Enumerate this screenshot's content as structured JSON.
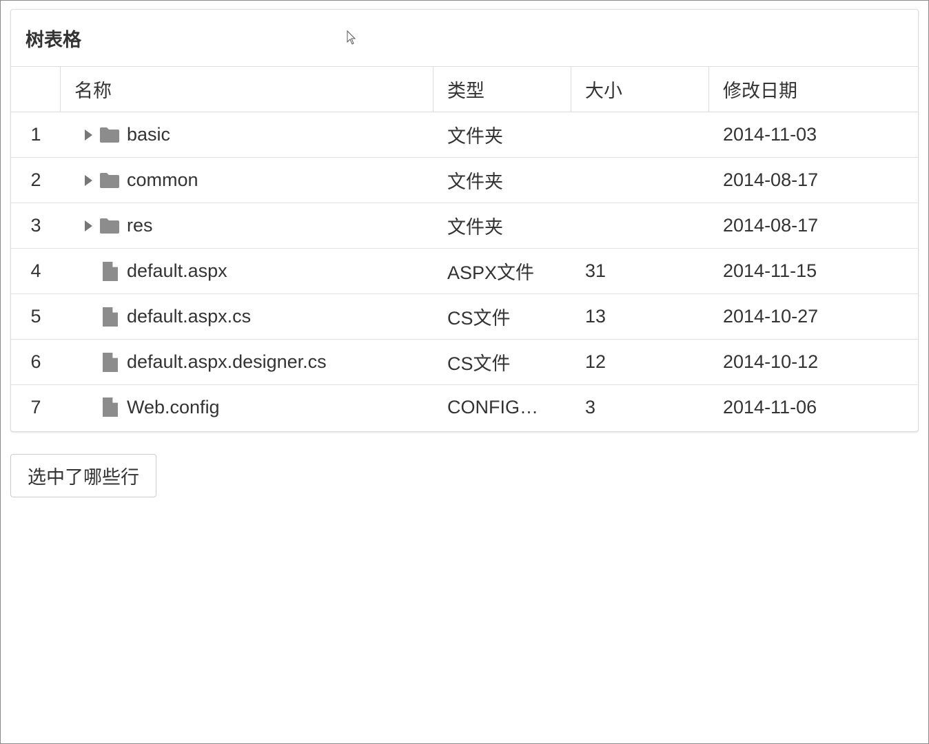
{
  "panel": {
    "title": "树表格"
  },
  "columns": {
    "num": "",
    "name": "名称",
    "type": "类型",
    "size": "大小",
    "date": "修改日期"
  },
  "rows": [
    {
      "num": "1",
      "name": "basic",
      "kind": "folder",
      "type": "文件夹",
      "size": "",
      "date": "2014-11-03"
    },
    {
      "num": "2",
      "name": "common",
      "kind": "folder",
      "type": "文件夹",
      "size": "",
      "date": "2014-08-17"
    },
    {
      "num": "3",
      "name": "res",
      "kind": "folder",
      "type": "文件夹",
      "size": "",
      "date": "2014-08-17"
    },
    {
      "num": "4",
      "name": "default.aspx",
      "kind": "file",
      "type": "ASPX文件",
      "size": "31",
      "date": "2014-11-15"
    },
    {
      "num": "5",
      "name": "default.aspx.cs",
      "kind": "file",
      "type": "CS文件",
      "size": "13",
      "date": "2014-10-27"
    },
    {
      "num": "6",
      "name": "default.aspx.designer.cs",
      "kind": "file",
      "type": "CS文件",
      "size": "12",
      "date": "2014-10-12"
    },
    {
      "num": "7",
      "name": "Web.config",
      "kind": "file",
      "type": "CONFIG…",
      "size": "3",
      "date": "2014-11-06"
    }
  ],
  "button": {
    "label": "选中了哪些行"
  },
  "icons": {
    "folder": "folder-icon",
    "file": "file-icon",
    "expand": "expand-arrow-icon",
    "color": "#8c8c8c"
  }
}
